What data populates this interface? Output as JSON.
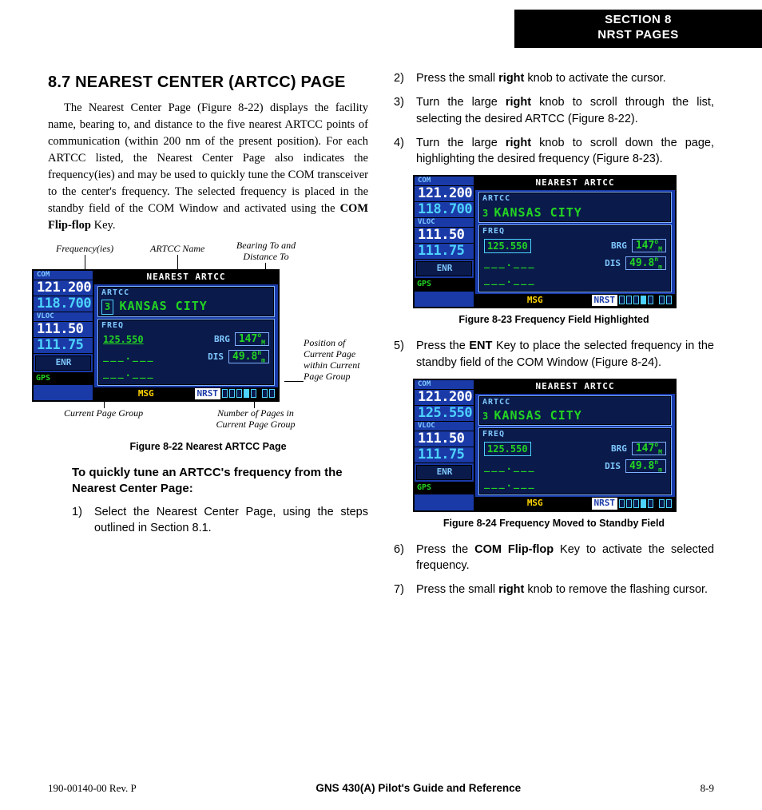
{
  "tab": {
    "line1": "SECTION 8",
    "line2": "NRST PAGES"
  },
  "left": {
    "heading": "8.7  NEAREST CENTER (ARTCC) PAGE",
    "intro_a": "The Nearest Center Page (Figure 8-22)  displays the facility name, bearing to, and distance to the five nearest ARTCC points of communication (within 200 nm of the present position).  For each ARTCC listed, the Nearest Center Page also indicates the frequency(ies) and may be used to quickly tune the COM transceiver to the center's frequency.  The selected frequency is placed in the standby field of the COM Window and activated using the ",
    "intro_b_bold": "COM Flip-flop",
    "intro_c": " Key.",
    "callouts": {
      "freq": "Frequency(ies)",
      "name": "ARTCC Name",
      "brgdis": "Bearing To and Distance To",
      "pos": "Position of Current Page within Current Page Group",
      "cur_group": "Current Page Group",
      "num_pages": "Number of Pages in Current Page Group"
    },
    "fig22_caption": "Figure 8-22  Nearest ARTCC Page",
    "proc_title": "To quickly tune an ARTCC's frequency from the Nearest Center Page:",
    "step1_a": "Select the Nearest Center Page, using the steps outlined in Section 8.1."
  },
  "right": {
    "step2_a": "Press the small ",
    "step2_b_bold": "right",
    "step2_c": " knob to activate the cursor.",
    "step3_a": "Turn the large ",
    "step3_b_bold": "right",
    "step3_c": " knob to scroll through the list, selecting the desired ARTCC (Figure 8-22).",
    "step4_a": "Turn the large ",
    "step4_b_bold": "right",
    "step4_c": " knob to scroll down the page, highlighting the desired frequency (Figure 8-23).",
    "fig23_caption": "Figure 8-23  Frequency Field Highlighted",
    "step5_a": "Press the ",
    "step5_b_bold": "ENT",
    "step5_c": " Key to place the selected frequency in the standby field of the COM Window (Figure 8-24).",
    "fig24_caption": "Figure 8-24 Frequency Moved to Standby Field",
    "step6_a": "Press the ",
    "step6_b_bold": "COM Flip-flop",
    "step6_c": " Key to activate the selected frequency.",
    "step7_a": "Press the small ",
    "step7_b_bold": "right",
    "step7_c": " knob to remove the flashing cursor."
  },
  "screens": {
    "title": "NEAREST ARTCC",
    "artcc_label": "ARTCC",
    "artcc_num": "3",
    "artcc_name": "KANSAS CITY",
    "freq_label": "FREQ",
    "freq": "125.550",
    "brg_label": "BRG",
    "brg_val": "147",
    "brg_unit_top": "o",
    "brg_unit_bot": "M",
    "dis_label": "DIS",
    "dis_val": "49.8",
    "dis_unit_top": "n",
    "dis_unit_bot": "m",
    "com_label": "COM",
    "com_active": "121.200",
    "com_standby_22": "118.700",
    "com_standby_23": "118.700",
    "com_standby_24": "125.550",
    "vloc_label": "VLOC",
    "vloc_active": "111.50",
    "vloc_standby": "111.75",
    "enr": "ENR",
    "gps": "GPS",
    "msg": "MSG",
    "nrst": "NRST"
  },
  "footer": {
    "left": "190-00140-00  Rev. P",
    "center": "GNS 430(A) Pilot's Guide and Reference",
    "right": "8-9"
  }
}
